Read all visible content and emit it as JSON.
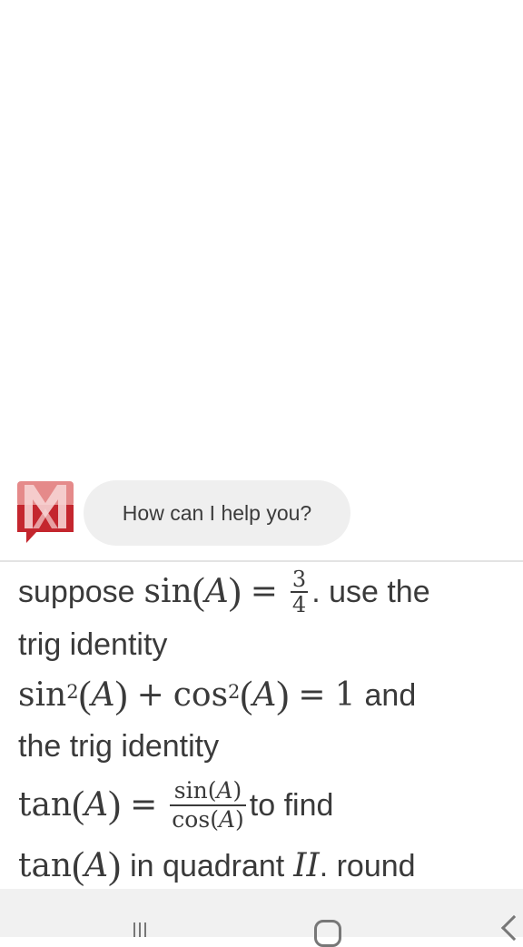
{
  "assistant": {
    "logo": "mathway-logo-icon",
    "logo_colors": {
      "light": "#e58a8a",
      "dark": "#c4262e"
    },
    "greeting": "How can I help you?"
  },
  "question": {
    "line1": {
      "pre": "suppose",
      "fn": "sin",
      "var": "A",
      "eq": "=",
      "num": "3",
      "den": "4",
      "post": ". use the"
    },
    "line2": "trig identity",
    "line3": {
      "fn1": "sin",
      "exp1": "2",
      "var1": "A",
      "plus": "+",
      "fn2": "cos",
      "exp2": "2",
      "var2": "A",
      "eq": "=",
      "rhs": "1",
      "post": "and"
    },
    "line4": "the trig identity",
    "line5": {
      "fn": "tan",
      "var": "A",
      "eq": "=",
      "num_fn": "sin",
      "num_var": "A",
      "den_fn": "cos",
      "den_var": "A",
      "post": "to find"
    },
    "line6": {
      "fn": "tan",
      "var": "A",
      "mid": "in quadrant",
      "quad": "II",
      "post": ". round"
    }
  },
  "navbar": {
    "recents": "recent-apps-icon",
    "home": "home-icon",
    "back": "back-icon"
  }
}
